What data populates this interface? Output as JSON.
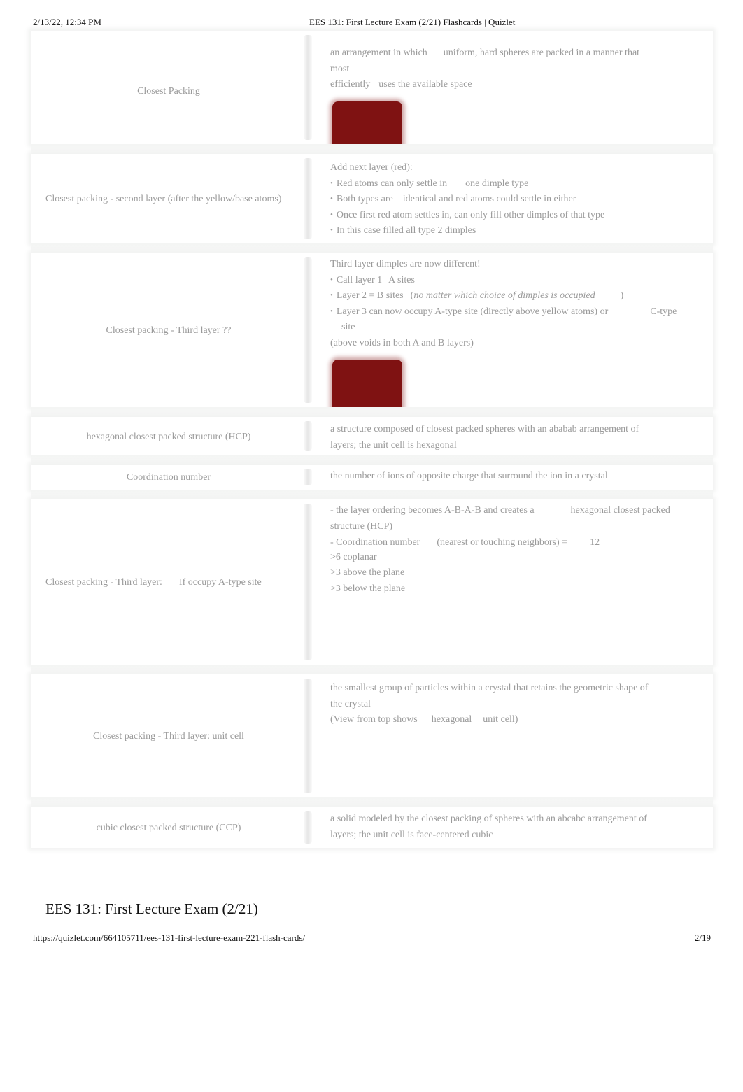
{
  "print_header": {
    "datetime": "2/13/22, 12:34 PM",
    "page_title": "EES 131: First Lecture Exam (2/21) Flashcards | Quizlet"
  },
  "cards": [
    {
      "term": "Closest Packing",
      "definition_lines": [
        [
          "an arrangement in which",
          "uniform, hard spheres are packed in a manner that",
          "most"
        ],
        [
          "efficiently",
          "uses the available space"
        ]
      ],
      "has_image": true,
      "image_color": "#7f1212"
    },
    {
      "term": "Closest packing - second layer (after the yellow/base atoms)",
      "definition_intro": "Add next layer (red):",
      "bullets": [
        [
          "Red atoms can only settle in",
          "one dimple type"
        ],
        [
          "Both types are",
          "identical and red atoms could settle in either"
        ],
        [
          "Once first red atom settles in, can only fill other dimples of that type"
        ],
        [
          "In this case filled all type 2 dimples"
        ]
      ]
    },
    {
      "term": "Closest packing - Third layer ??",
      "definition_intro": "Third layer dimples are now different!",
      "bullets": [
        [
          "Call layer 1",
          "A sites"
        ],
        [
          "Layer 2 =",
          "B sites",
          "(",
          "no matter which choice of dimples is occupied",
          ")"
        ],
        [
          "Layer 3 can now occupy A-type site (directly above yellow atoms) or",
          "C-type",
          "site"
        ]
      ],
      "continuation": "(above voids in both A and B layers)",
      "has_image": true,
      "image_color": "#7f1212"
    },
    {
      "term": "hexagonal closest packed structure (HCP)",
      "definition_lines": [
        "a structure composed of closest packed spheres with an ababab arrangement of",
        "layers; the unit cell is hexagonal"
      ]
    },
    {
      "term": "Coordination number",
      "definition_lines": [
        "the number of ions of opposite charge that surround the ion in a crystal"
      ]
    },
    {
      "term_parts": [
        "Closest packing - Third layer:",
        "If occupy A-type site"
      ],
      "definition_parts": {
        "line1": [
          "- the layer ordering becomes A-B-A-B and creates a",
          "hexagonal closest packed"
        ],
        "line2": "structure (HCP)",
        "line3": [
          "- ",
          "Coordination number",
          "(nearest or touching neighbors) =",
          "12"
        ],
        "line4": ">6 coplanar",
        "line5": ">3 above the plane",
        "line6": ">3 below the plane"
      }
    },
    {
      "term": "Closest packing - Third layer: unit cell",
      "definition_lines": [
        "the smallest group of particles within a crystal that retains the geometric shape of",
        "the crystal"
      ],
      "extra_parts": [
        "(View from top shows",
        "hexagonal",
        "unit cell)"
      ]
    },
    {
      "term": "cubic closest packed structure (CCP)",
      "definition_lines": [
        "a solid modeled by the closest packing of spheres with an abcabc arrangement of",
        "layers; the unit cell is face-centered cubic"
      ]
    }
  ],
  "set_title": "EES 131: First Lecture Exam (2/21)",
  "print_footer": {
    "url": "https://quizlet.com/664105711/ees-131-first-lecture-exam-221-flash-cards/",
    "page": "2/19"
  }
}
